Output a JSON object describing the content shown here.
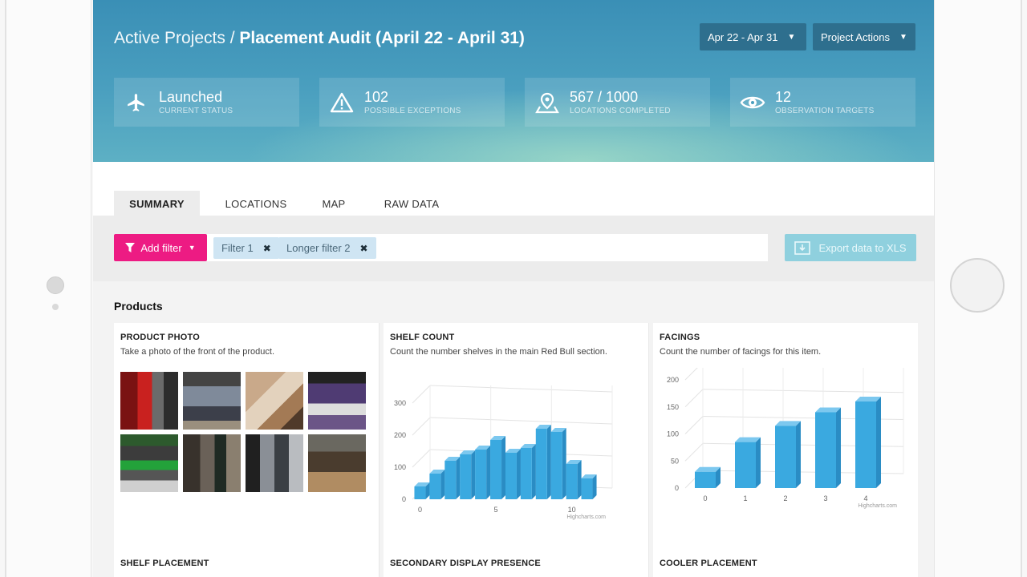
{
  "header": {
    "breadcrumb_parent": "Active Projects /",
    "title": "Placement Audit (April 22 - April 31)",
    "date_range_label": "Apr 22 - Apr 31",
    "actions_label": "Project Actions"
  },
  "stats": [
    {
      "icon": "airplane-icon",
      "value": "Launched",
      "label": "CURRENT STATUS"
    },
    {
      "icon": "warning-icon",
      "value": "102",
      "label": "POSSIBLE EXCEPTIONS"
    },
    {
      "icon": "location-pin-icon",
      "value": "567 / 1000",
      "label": "LOCATIONS COMPLETED"
    },
    {
      "icon": "eye-icon",
      "value": "12",
      "label": "OBSERVATION TARGETS"
    }
  ],
  "tabs": [
    {
      "label": "SUMMARY",
      "active": true
    },
    {
      "label": "LOCATIONS",
      "active": false
    },
    {
      "label": "MAP",
      "active": false
    },
    {
      "label": "RAW DATA",
      "active": false
    }
  ],
  "filters": {
    "add_label": "Add filter",
    "chips": [
      "Filter 1",
      "Longer filter 2"
    ],
    "export_label": "Export data to XLS"
  },
  "section_title": "Products",
  "cards": [
    {
      "title": "PRODUCT PHOTO",
      "desc": "Take a photo of the front of the product."
    },
    {
      "title": "SHELF COUNT",
      "desc": "Count the number shelves in the main Red Bull section."
    },
    {
      "title": "FACINGS",
      "desc": "Count the number of facings for this item."
    }
  ],
  "lower_cards": [
    {
      "title": "SHELF PLACEMENT"
    },
    {
      "title": "SECONDARY DISPLAY PRESENCE"
    },
    {
      "title": "COOLER PLACEMENT"
    }
  ],
  "colors": {
    "accent_pink": "#ed1b83",
    "bar_blue": "#3aa9e0",
    "chip_bg": "#cfe5f3",
    "export_bg": "#8fd0de"
  },
  "chart_data": [
    {
      "type": "bar",
      "x": [
        0,
        1,
        2,
        3,
        4,
        5,
        6,
        7,
        8,
        9,
        10,
        11
      ],
      "values": [
        40,
        80,
        120,
        140,
        155,
        185,
        145,
        160,
        220,
        210,
        110,
        65
      ],
      "ylim": [
        0,
        300
      ],
      "yticks": [
        0,
        100,
        200,
        300
      ],
      "xticks": [
        0,
        5,
        10
      ],
      "credit": "Highcharts.com"
    },
    {
      "type": "bar",
      "x": [
        0,
        1,
        2,
        3,
        4
      ],
      "values": [
        30,
        85,
        115,
        140,
        160
      ],
      "ylim": [
        0,
        200
      ],
      "yticks": [
        0,
        50,
        100,
        150,
        200
      ],
      "xticks": [
        0,
        1,
        2,
        3,
        4
      ],
      "credit": "Highcharts.com"
    }
  ]
}
